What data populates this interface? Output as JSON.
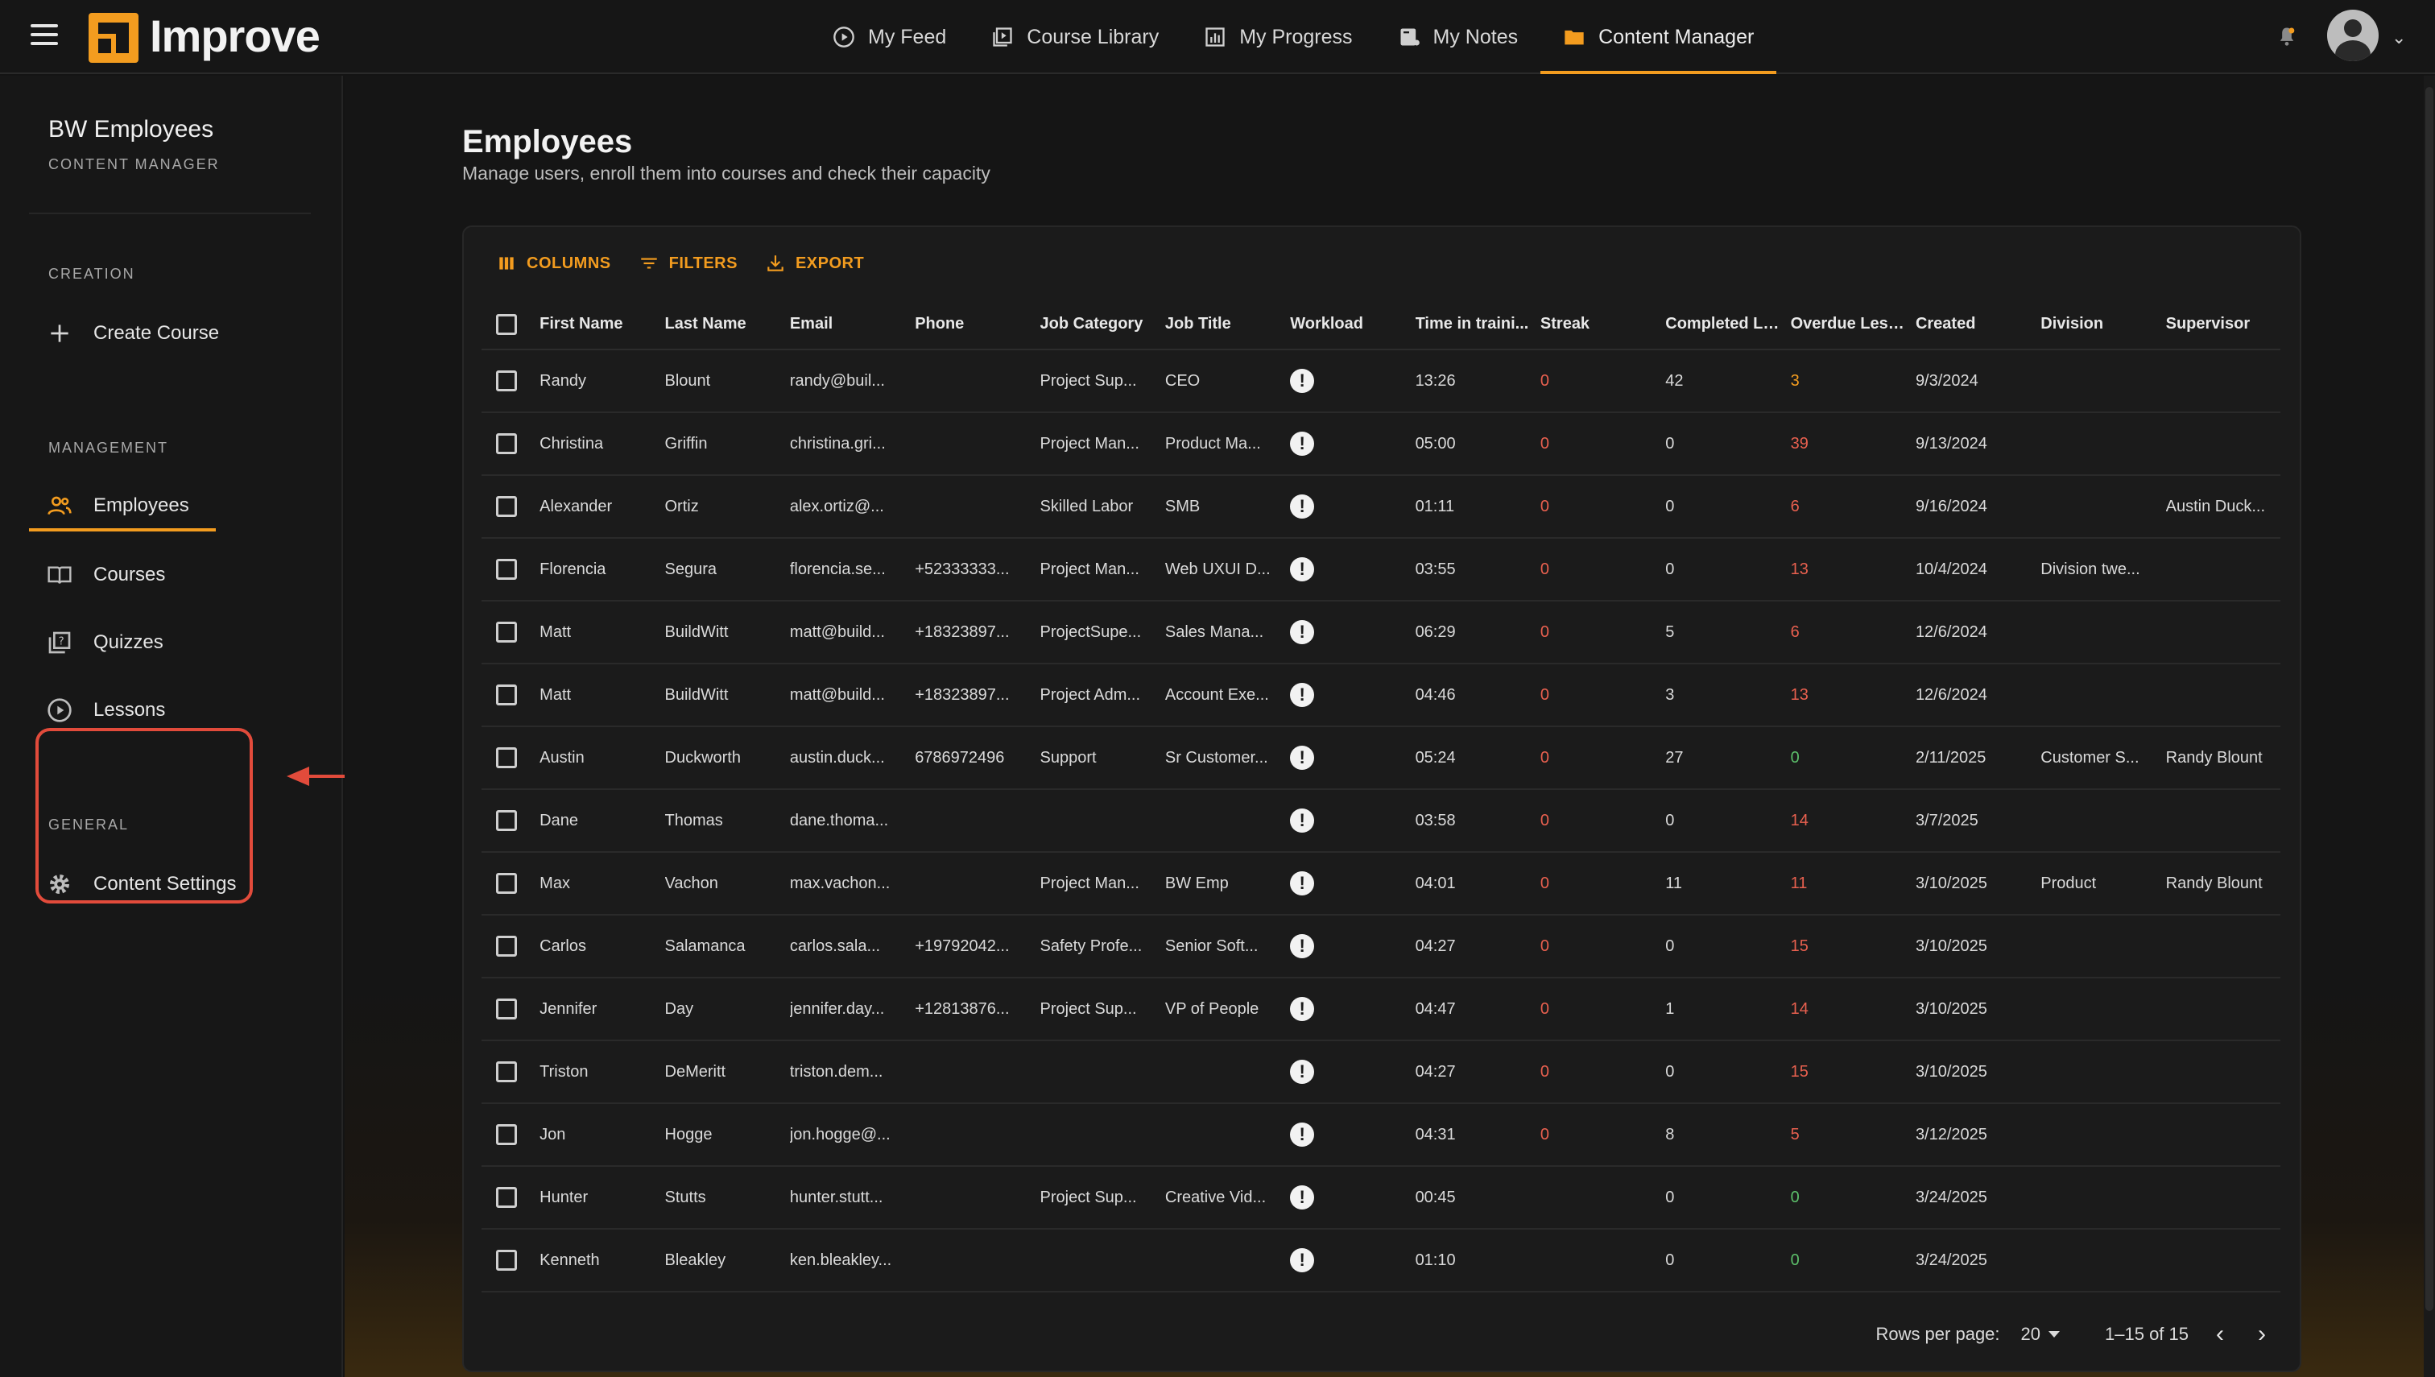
{
  "app": {
    "brand": "Improve"
  },
  "nav": {
    "items": [
      {
        "label": "My Feed",
        "icon": "play-circle-icon"
      },
      {
        "label": "Course Library",
        "icon": "video-library-icon"
      },
      {
        "label": "My Progress",
        "icon": "bar-chart-icon"
      },
      {
        "label": "My Notes",
        "icon": "notes-icon"
      },
      {
        "label": "Content Manager",
        "icon": "folder-icon",
        "active": true
      }
    ]
  },
  "sidebar": {
    "title": "BW Employees",
    "subtitle": "CONTENT MANAGER",
    "creation_label": "CREATION",
    "create_course": "Create Course",
    "management_label": "MANAGEMENT",
    "management_items": [
      {
        "label": "Employees",
        "icon": "people-icon",
        "active": true
      },
      {
        "label": "Courses",
        "icon": "book-icon"
      },
      {
        "label": "Quizzes",
        "icon": "quiz-icon"
      },
      {
        "label": "Lessons",
        "icon": "play-circle-icon"
      }
    ],
    "general_label": "GENERAL",
    "content_settings": "Content Settings"
  },
  "page": {
    "title": "Employees",
    "subtitle": "Manage users, enroll them into courses and check their capacity"
  },
  "toolbar": {
    "columns": "COLUMNS",
    "filters": "FILTERS",
    "export": "EXPORT"
  },
  "table": {
    "headers": [
      "First Name",
      "Last Name",
      "Email",
      "Phone",
      "Job Category",
      "Job Title",
      "Workload",
      "Time in traini...",
      "Streak",
      "Completed Le...",
      "Overdue Less...",
      "Created",
      "Division",
      "Supervisor"
    ],
    "rows": [
      [
        "Randy",
        "Blount",
        "randy@buil...",
        "",
        "Project Sup...",
        "CEO",
        "!",
        "13:26",
        "0",
        "42",
        "3",
        "9/3/2024",
        "",
        ""
      ],
      [
        "Christina",
        "Griffin",
        "christina.gri...",
        "",
        "Project Man...",
        "Product Ma...",
        "!",
        "05:00",
        "0",
        "0",
        "39",
        "9/13/2024",
        "",
        ""
      ],
      [
        "Alexander",
        "Ortiz",
        "alex.ortiz@...",
        "",
        "Skilled Labor",
        "SMB",
        "!",
        "01:11",
        "0",
        "0",
        "6",
        "9/16/2024",
        "",
        "Austin Duck..."
      ],
      [
        "Florencia",
        "Segura",
        "florencia.se...",
        "+52333333...",
        "Project Man...",
        "Web UXUI D...",
        "!",
        "03:55",
        "0",
        "0",
        "13",
        "10/4/2024",
        "Division twe...",
        ""
      ],
      [
        "Matt",
        "BuildWitt",
        "matt@build...",
        "+18323897...",
        "ProjectSupe...",
        "Sales Mana...",
        "!",
        "06:29",
        "0",
        "5",
        "6",
        "12/6/2024",
        "",
        ""
      ],
      [
        "Matt",
        "BuildWitt",
        "matt@build...",
        "+18323897...",
        "Project Adm...",
        "Account Exe...",
        "!",
        "04:46",
        "0",
        "3",
        "13",
        "12/6/2024",
        "",
        ""
      ],
      [
        "Austin",
        "Duckworth",
        "austin.duck...",
        "6786972496",
        "Support",
        "Sr Customer...",
        "!",
        "05:24",
        "0",
        "27",
        "0",
        "2/11/2025",
        "Customer S...",
        "Randy Blount"
      ],
      [
        "Dane",
        "Thomas",
        "dane.thoma...",
        "",
        "",
        "",
        "!",
        "03:58",
        "0",
        "0",
        "14",
        "3/7/2025",
        "",
        ""
      ],
      [
        "Max",
        "Vachon",
        "max.vachon...",
        "",
        "Project Man...",
        "BW Emp",
        "!",
        "04:01",
        "0",
        "11",
        "11",
        "3/10/2025",
        "Product",
        "Randy Blount"
      ],
      [
        "Carlos",
        "Salamanca",
        "carlos.sala...",
        "+19792042...",
        "Safety Profe...",
        "Senior Soft...",
        "!",
        "04:27",
        "0",
        "0",
        "15",
        "3/10/2025",
        "",
        ""
      ],
      [
        "Jennifer",
        "Day",
        "jennifer.day...",
        "+12813876...",
        "Project Sup...",
        "VP of People",
        "!",
        "04:47",
        "0",
        "1",
        "14",
        "3/10/2025",
        "",
        ""
      ],
      [
        "Triston",
        "DeMeritt",
        "triston.dem...",
        "",
        "",
        "",
        "!",
        "04:27",
        "0",
        "0",
        "15",
        "3/10/2025",
        "",
        ""
      ],
      [
        "Jon",
        "Hogge",
        "jon.hogge@...",
        "",
        "",
        "",
        "!",
        "04:31",
        "0",
        "8",
        "5",
        "3/12/2025",
        "",
        ""
      ],
      [
        "Hunter",
        "Stutts",
        "hunter.stutt...",
        "",
        "Project Sup...",
        "Creative Vid...",
        "!",
        "00:45",
        "",
        "0",
        "0",
        "3/24/2025",
        "",
        ""
      ],
      [
        "Kenneth",
        "Bleakley",
        "ken.bleakley...",
        "",
        "",
        "",
        "!",
        "01:10",
        "",
        "0",
        "0",
        "3/24/2025",
        "",
        ""
      ]
    ],
    "overdue_colors": [
      "orange",
      "red",
      "red",
      "red",
      "red",
      "red",
      "green",
      "red",
      "red",
      "red",
      "red",
      "red",
      "red",
      "green",
      "green"
    ]
  },
  "pagination": {
    "rows_per_page_label": "Rows per page:",
    "rows_per_page": "20",
    "range": "1–15 of 15"
  },
  "colors": {
    "accent": "#f39c1f",
    "annotation": "#e24b3b",
    "negative": "#e8604f",
    "positive": "#5cbf6a"
  }
}
